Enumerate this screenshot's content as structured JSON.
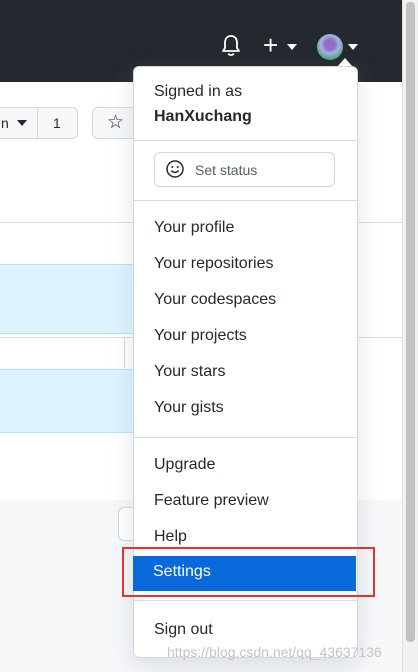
{
  "header": {
    "bell_icon": "bell-icon",
    "plus_label": "+",
    "avatar_icon": "avatar"
  },
  "repo_actions": {
    "watch_count": "1",
    "star_icon": "star-icon"
  },
  "dropdown": {
    "signed_in_label": "Signed in as",
    "username": "HanXuchang",
    "set_status": "Set status",
    "profile_items": [
      "Your profile",
      "Your repositories",
      "Your codespaces",
      "Your projects",
      "Your stars",
      "Your gists"
    ],
    "misc_items": [
      "Upgrade",
      "Feature preview",
      "Help",
      "Settings"
    ],
    "sign_out": "Sign out",
    "active_item": "Settings"
  },
  "watermark": "https://blog.csdn.net/qq_43637136",
  "colors": {
    "topbar": "#24292f",
    "active_bg": "#0969da",
    "highlight_box": "#e8332b"
  }
}
